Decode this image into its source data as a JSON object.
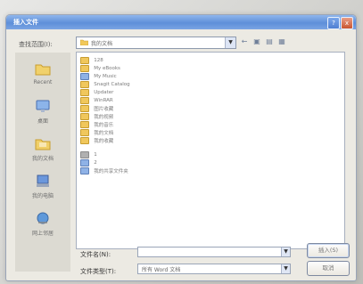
{
  "dialog": {
    "title": "插入文件",
    "help": "?",
    "close": "x"
  },
  "lookin": {
    "label": "查找范围(I):",
    "value": "我的文档"
  },
  "places": [
    {
      "label": "Recent",
      "icon": "recent-icon"
    },
    {
      "label": "桌面",
      "icon": "desktop-icon"
    },
    {
      "label": "我的文档",
      "icon": "documents-icon"
    },
    {
      "label": "我的电脑",
      "icon": "computer-icon"
    },
    {
      "label": "网上邻居",
      "icon": "network-icon"
    }
  ],
  "items": [
    {
      "text": "128",
      "type": "folder"
    },
    {
      "text": "My eBooks",
      "type": "folder"
    },
    {
      "text": "My Music",
      "type": "blue"
    },
    {
      "text": "Snagit Catalog",
      "type": "folder"
    },
    {
      "text": "Updater",
      "type": "folder"
    },
    {
      "text": "WinRAR",
      "type": "folder"
    },
    {
      "text": "图片收藏",
      "type": "folder"
    },
    {
      "text": "我的视频",
      "type": "folder"
    },
    {
      "text": "我的音乐",
      "type": "folder"
    },
    {
      "text": "我的文档",
      "type": "folder"
    },
    {
      "text": "我的收藏",
      "type": "folder"
    },
    {
      "text": "1",
      "type": "gray"
    },
    {
      "text": "2",
      "type": "blue"
    },
    {
      "text": "我的共享文件夹",
      "type": "blue"
    }
  ],
  "filename": {
    "label": "文件名(N):",
    "value": ""
  },
  "filetype": {
    "label": "文件类型(T):",
    "value": "所有 Word 文档"
  },
  "buttons": {
    "open": "插入(S)",
    "cancel": "取消"
  }
}
